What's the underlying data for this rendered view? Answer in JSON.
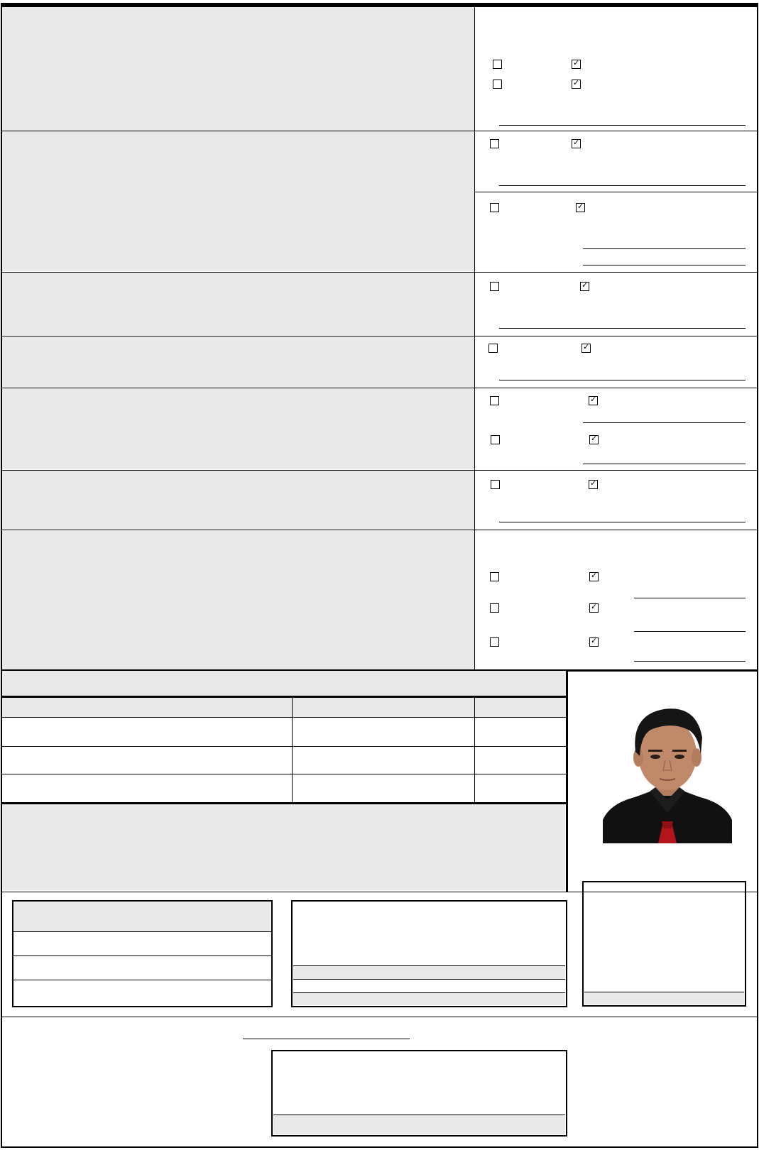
{
  "questions": {
    "q34_related_by_consanguinity": {
      "a_third_degree": false,
      "b_fourth_degree": false
    },
    "q35_offenses": {
      "a_found_guilty": false,
      "b_criminally_charged": false
    },
    "q36_convicted": false,
    "q37_separated_from_service": false,
    "q38_candidate_or_resigned": {
      "a_candidate": false,
      "b_resigned": false
    },
    "q39_immigrant": false,
    "q40_special_groups": {
      "a_indigenous": false,
      "b_pwd": false,
      "c_solo_parent": false
    }
  },
  "checkbox_states": {
    "yes": false,
    "no": true
  },
  "photo": {
    "description": "passport photo",
    "background": "#ffffff",
    "shirt_color": "#111111",
    "tie_color": "#b3151b",
    "skin_color": "#c08a6a"
  },
  "colors": {
    "section_fill": "#e9e9e9",
    "border": "#000000"
  }
}
